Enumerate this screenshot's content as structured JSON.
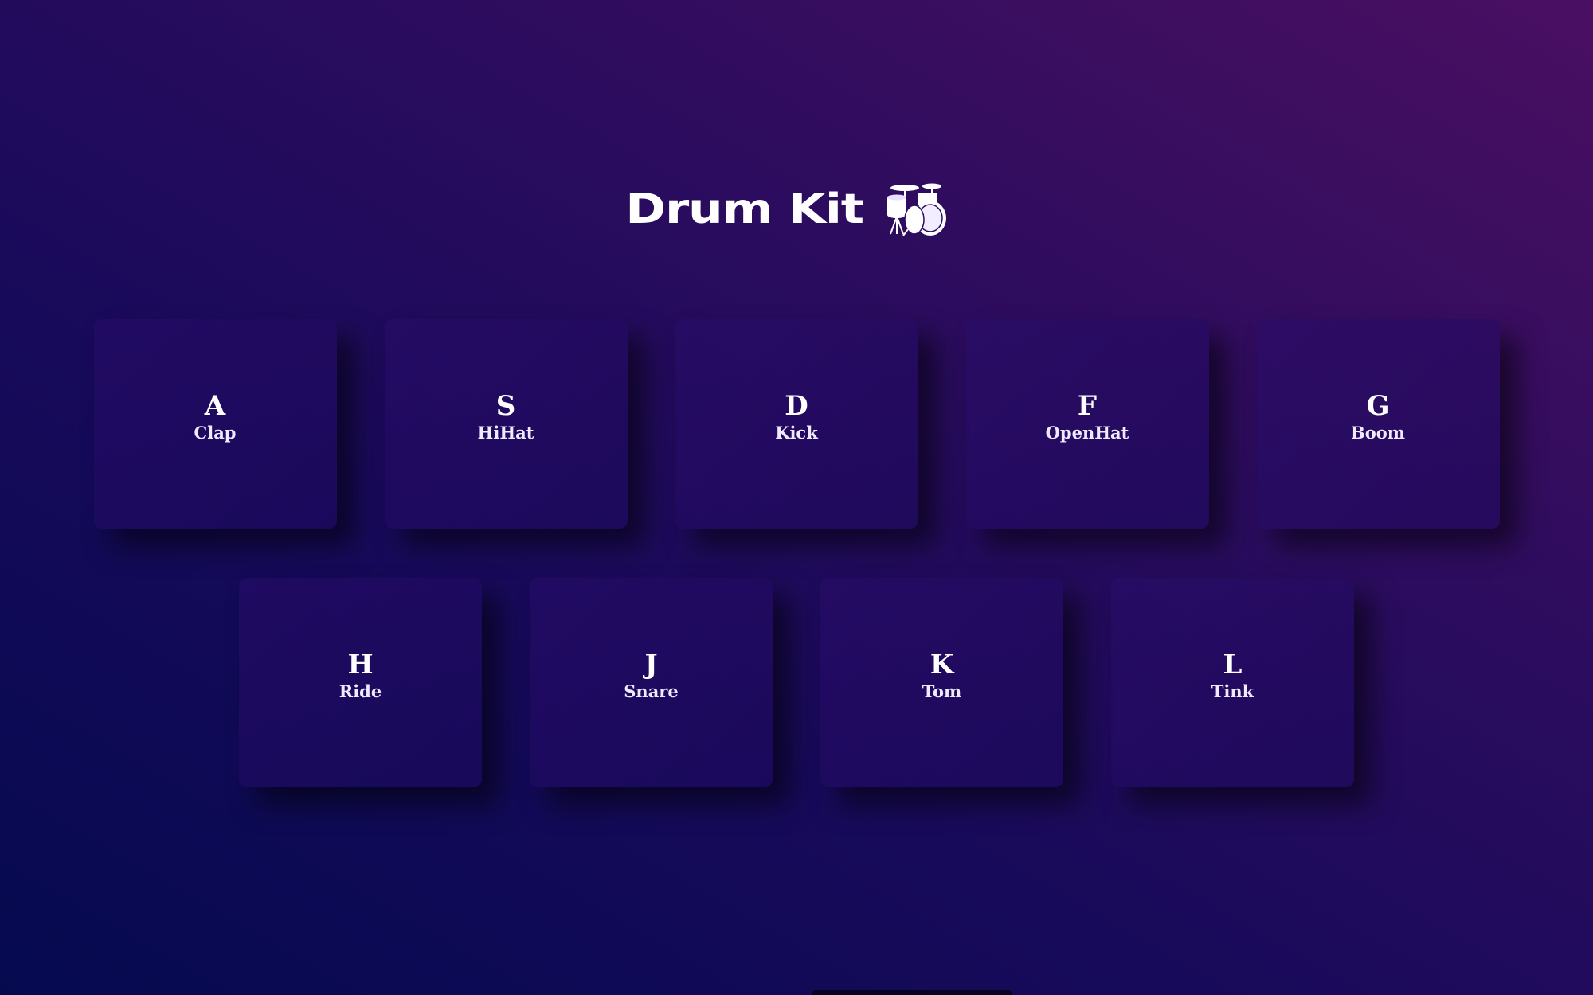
{
  "header": {
    "title": "Drum Kit",
    "icon": "drum-kit-icon"
  },
  "keys": [
    {
      "letter": "A",
      "sound": "Clap"
    },
    {
      "letter": "S",
      "sound": "HiHat"
    },
    {
      "letter": "D",
      "sound": "Kick"
    },
    {
      "letter": "F",
      "sound": "OpenHat"
    },
    {
      "letter": "G",
      "sound": "Boom"
    },
    {
      "letter": "H",
      "sound": "Ride"
    },
    {
      "letter": "J",
      "sound": "Snare"
    },
    {
      "letter": "K",
      "sound": "Tom"
    },
    {
      "letter": "L",
      "sound": "Tink"
    }
  ],
  "colors": {
    "background_start": "#050a4f",
    "background_end": "#4a0f62",
    "text": "#ffffff"
  }
}
